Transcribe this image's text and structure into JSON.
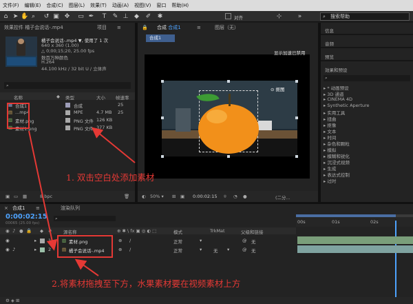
{
  "menu": [
    "文件(F)",
    "编辑(E)",
    "合成(C)",
    "图层(L)",
    "效果(T)",
    "动画(A)",
    "视图(V)",
    "窗口",
    "帮助(H)"
  ],
  "toolbar": {
    "snap_label": "对齐",
    "search_placeholder": "搜索帮助"
  },
  "project": {
    "header_title": "效果控件 橘子会说话-.mp4",
    "tab_project": "项目",
    "clip_name": "橘子会说话-.mp4 ▼, 使用了 1 次",
    "clip_info": [
      "640 x 360 (1.00)",
      "△ 0;00;15;20, 25.00 fps",
      "数百万种颜色",
      "H.264",
      "44.100 kHz / 32 bit U / 立体声"
    ],
    "search_icon": "search-icon",
    "columns": [
      "名称",
      "类型",
      "大小",
      "帧速率"
    ],
    "items": [
      {
        "name": "合成1",
        "type": "合成",
        "size": "",
        "fps": "25"
      },
      {
        "name": "...mp4",
        "type": "MPE",
        "size": "4.7 MB",
        "fps": "25"
      },
      {
        "name": "素材.png",
        "type": "PNG 文件",
        "size": "126 KB",
        "fps": ""
      },
      {
        "name": "素材1.png",
        "type": "PNG 文件",
        "size": "377 KB",
        "fps": ""
      }
    ],
    "bpc": "8 bpc"
  },
  "composition": {
    "tab_prefix": "合成",
    "tab_name": "合成1",
    "layer_tab": "图层（无）",
    "sub_tab": "合成1",
    "accel_text": "显示加速已禁用",
    "snapshot_text": "抠图",
    "zoom": "50%",
    "timecode": "0:00:02:15",
    "res": "(二分..."
  },
  "right": {
    "tabs": [
      "信息",
      "音频",
      "预览"
    ],
    "effects_title": "效果和预设",
    "effects": [
      "* 动画预设",
      "3D 通道",
      "CINEMA 4D",
      "Synthetic Aperture",
      "实用工具",
      "扭曲",
      "抠像",
      "文本",
      "时间",
      "杂色和颗粒",
      "模拟",
      "模糊和锐化",
      "沉浸式视频",
      "生成",
      "表达式控制",
      "过时"
    ]
  },
  "timeline": {
    "tab_comp": "合成1",
    "tab_render": "渲染队列",
    "timecode": "0:00:02:15",
    "frames": "00065 (25.00 fps)",
    "col_name": "源名称",
    "col_mode": "模式",
    "col_trkmat": "TrkMat",
    "col_parent": "父级和链接",
    "ruler": [
      "00s",
      "01s",
      "02s"
    ],
    "layers": [
      {
        "num": "1",
        "name": "素材.png",
        "mode": "正常",
        "trkmat": "",
        "parent": "无"
      },
      {
        "num": "2",
        "name": "橘子会说话-.mp4",
        "mode": "正常",
        "trkmat": "无",
        "parent": "无"
      }
    ]
  },
  "annotations": {
    "step1": "1. 双击空白处添加素材",
    "step2": "2.将素材拖拽至下方，水果素材要在视频素材上方"
  }
}
